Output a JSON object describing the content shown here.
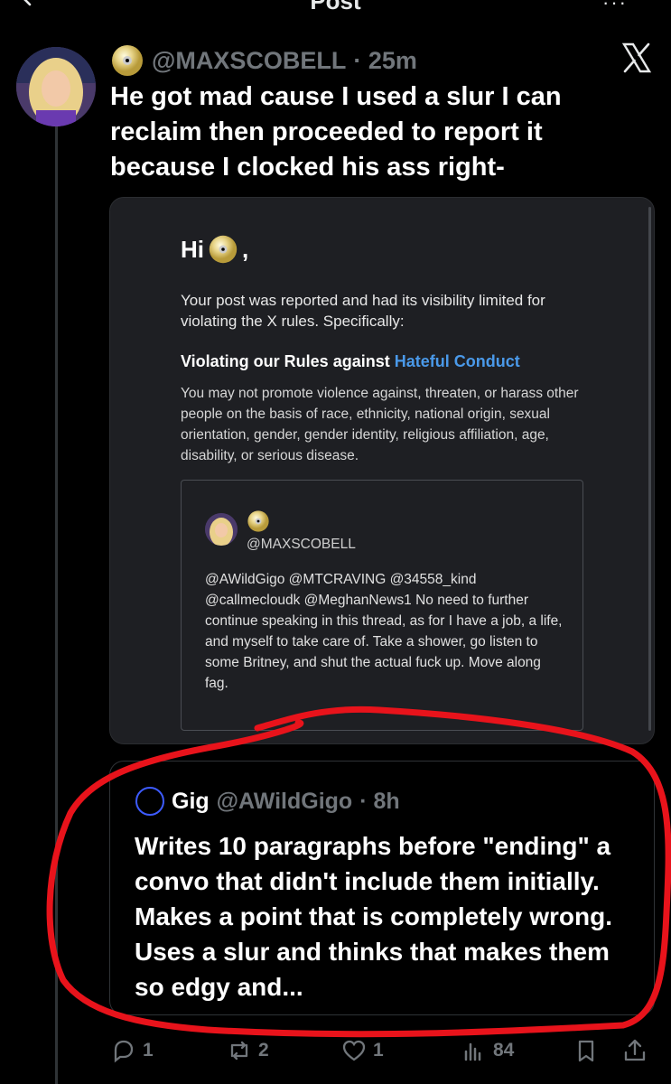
{
  "header": {
    "title": "Post",
    "back_icon": "arrow-left-icon",
    "more_icon": "more-icon",
    "more_text": "···"
  },
  "post": {
    "handle": "@MAXSCOBELL",
    "time": "· 25m",
    "text": "He got mad cause I used a slur I can reclaim then proceeded to report it because I clocked his ass right-"
  },
  "report_card": {
    "greeting": "Hi",
    "greeting_suffix": ",",
    "intro": "Your post was reported and had its visibility limited for violating the X rules. Specifically:",
    "rule_prefix": "Violating our Rules against",
    "rule_link": "Hateful Conduct",
    "rule_description": "You may not promote violence against, threaten, or harass other people on the basis of race, ethnicity, national origin, sexual orientation, gender, gender identity, religious affiliation, age, disability, or serious disease.",
    "embedded_handle": "@MAXSCOBELL",
    "embedded_text": "@AWildGigo @MTCRAVING @34558_kind @callmecloudk @MeghanNews1 No need to further continue speaking in this thread, as for I have a job, a life, and myself to take care of. Take a shower, go listen to some Britney, and shut the actual fuck up. Move along fag."
  },
  "quote": {
    "name": "Gig",
    "handle": "@AWildGigo",
    "time": "· 8h",
    "text": "Writes 10 paragraphs before \"ending\" a convo that didn't include them initially. Makes a point that is completely wrong. Uses a slur and thinks that makes them so edgy and..."
  },
  "actions": {
    "replies": "1",
    "reposts": "2",
    "likes": "1",
    "views": "84"
  },
  "colors": {
    "annotation_red": "#e8131b",
    "link_blue": "#4a99e9",
    "muted": "#71767b"
  }
}
